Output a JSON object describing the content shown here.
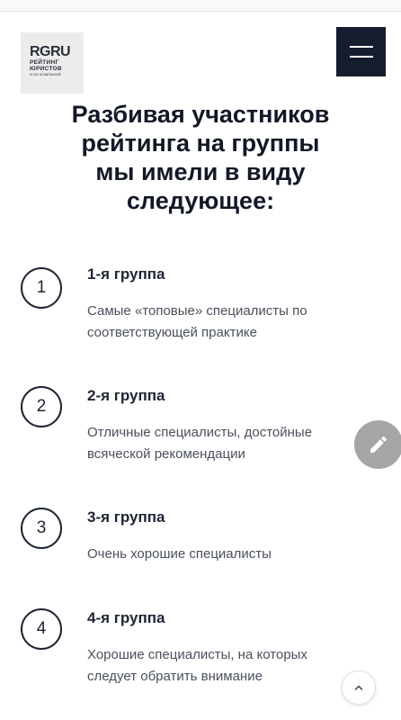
{
  "logo": {
    "main": "RGRU",
    "sub_line1": "РЕЙТИНГ",
    "sub_line2": "ЮРИСТОВ",
    "sub_line3": "И ИХ КОМПАНИЙ"
  },
  "header": {
    "menu_icon": "hamburger-icon"
  },
  "headline": {
    "lines": [
      "Разбивая участников",
      "рейтинга на группы",
      "мы имели в виду",
      "следующее:"
    ]
  },
  "groups": [
    {
      "number": "1",
      "title": "1-я группа",
      "desc_lines": [
        "Самые «топовые» специалисты по",
        "соответствующей практике"
      ]
    },
    {
      "number": "2",
      "title": "2-я группа",
      "desc_lines": [
        "Отличные специалисты, достойные",
        "всяческой рекомендации"
      ]
    },
    {
      "number": "3",
      "title": "3-я группа",
      "desc_lines": [
        "Очень хорошие специалисты"
      ]
    },
    {
      "number": "4",
      "title": "4-я группа",
      "desc_lines": [
        "Хорошие специалисты, на которых",
        "следует обратить внимание"
      ]
    }
  ],
  "fab": {
    "icon": "pencil-icon"
  },
  "scroll_top": {
    "icon": "chevron-up-icon"
  },
  "colors": {
    "navy": "#161d2e",
    "text": "#1d2433",
    "muted": "#4a505c",
    "fab": "#a6a6a6"
  }
}
